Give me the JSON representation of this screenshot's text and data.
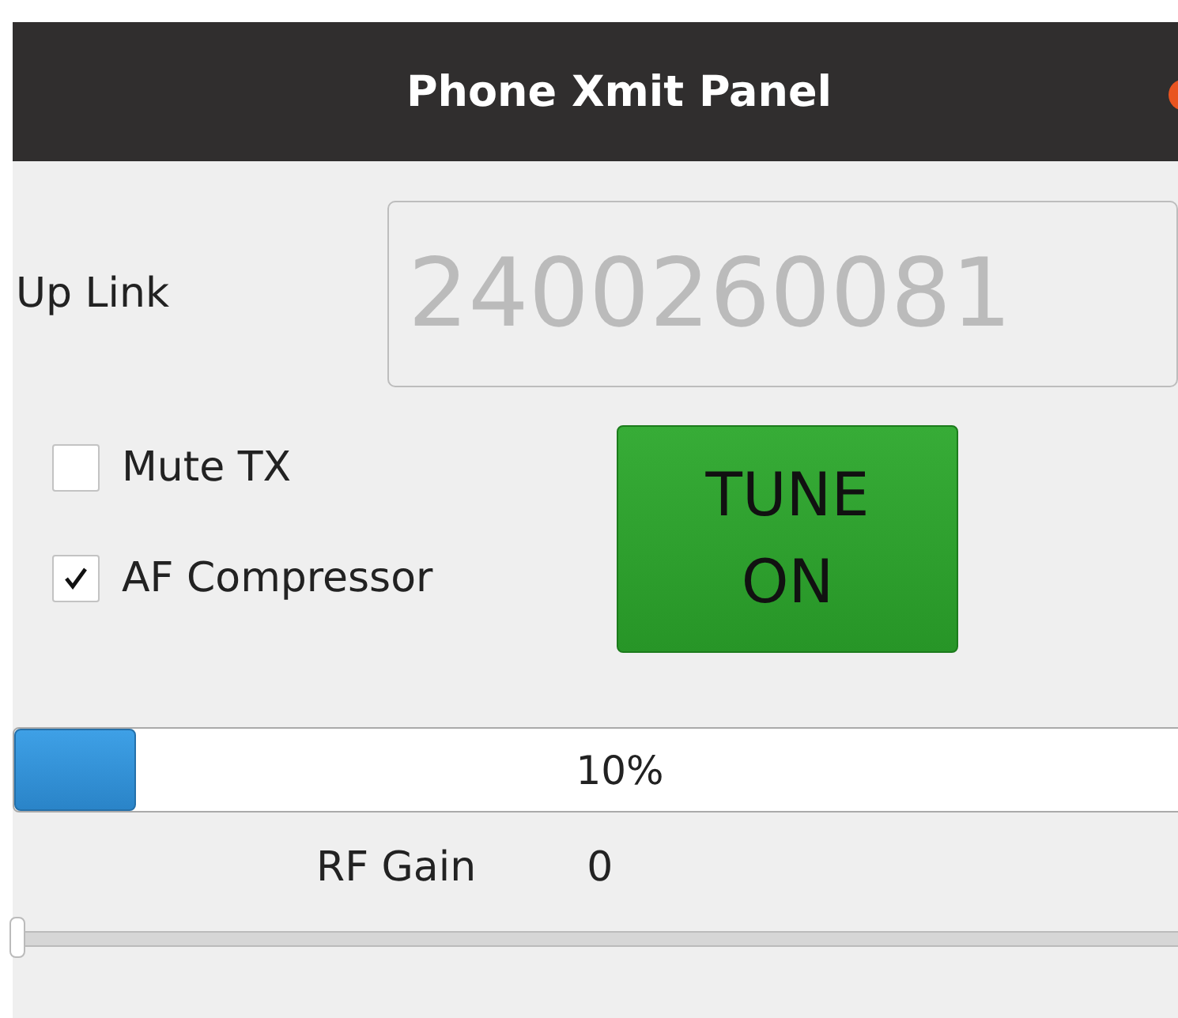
{
  "window": {
    "title": "Phone Xmit Panel"
  },
  "uplink": {
    "label": "Up Link",
    "value": "2400260081"
  },
  "options": [
    {
      "label": "Mute TX",
      "checked": false
    },
    {
      "label": "AF Compressor",
      "checked": true
    }
  ],
  "tune_button": {
    "label": "TUNE ON",
    "on": true
  },
  "progress": {
    "level": 0.1,
    "reading": "10%"
  },
  "rf_gain": {
    "label": "RF Gain",
    "reading": "0",
    "level": 0
  }
}
